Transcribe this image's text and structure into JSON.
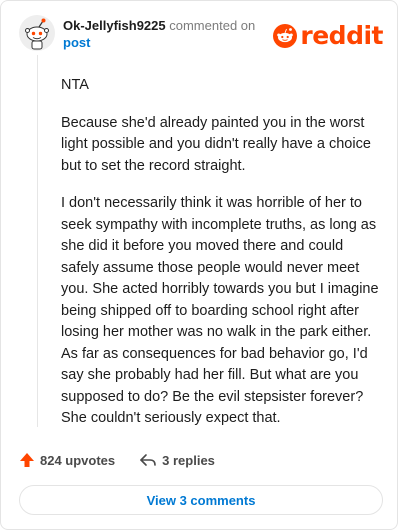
{
  "header": {
    "username": "Ok-Jellyfish9225",
    "action_text": "commented on",
    "post_link": "post",
    "logo_text": "reddit"
  },
  "comment": {
    "paragraphs": [
      "NTA",
      "Because she'd already painted you in the worst light possible and you didn't really have a choice but to set the record straight.",
      "I don't necessarily think it was horrible of her to seek sympathy with incomplete truths, as long as she did it before you moved there and could safely assume those people would never meet you. She acted horribly towards you but I imagine being shipped off to boarding school right after losing her mother was no walk in the park either. As far as consequences for bad behavior go, I'd say she probably had her fill. But what are you supposed to do? Be the evil stepsister forever? She couldn't seriously expect that."
    ]
  },
  "footer": {
    "upvotes": "824 upvotes",
    "replies": "3 replies",
    "view_comments": "View 3 comments"
  },
  "colors": {
    "brand": "#ff4500",
    "link": "#0079d3"
  },
  "icons": {
    "avatar": "snoo-avatar-icon",
    "logo": "reddit-snoo-icon",
    "upvote": "arrow-up-icon",
    "reply": "reply-arrow-icon"
  }
}
